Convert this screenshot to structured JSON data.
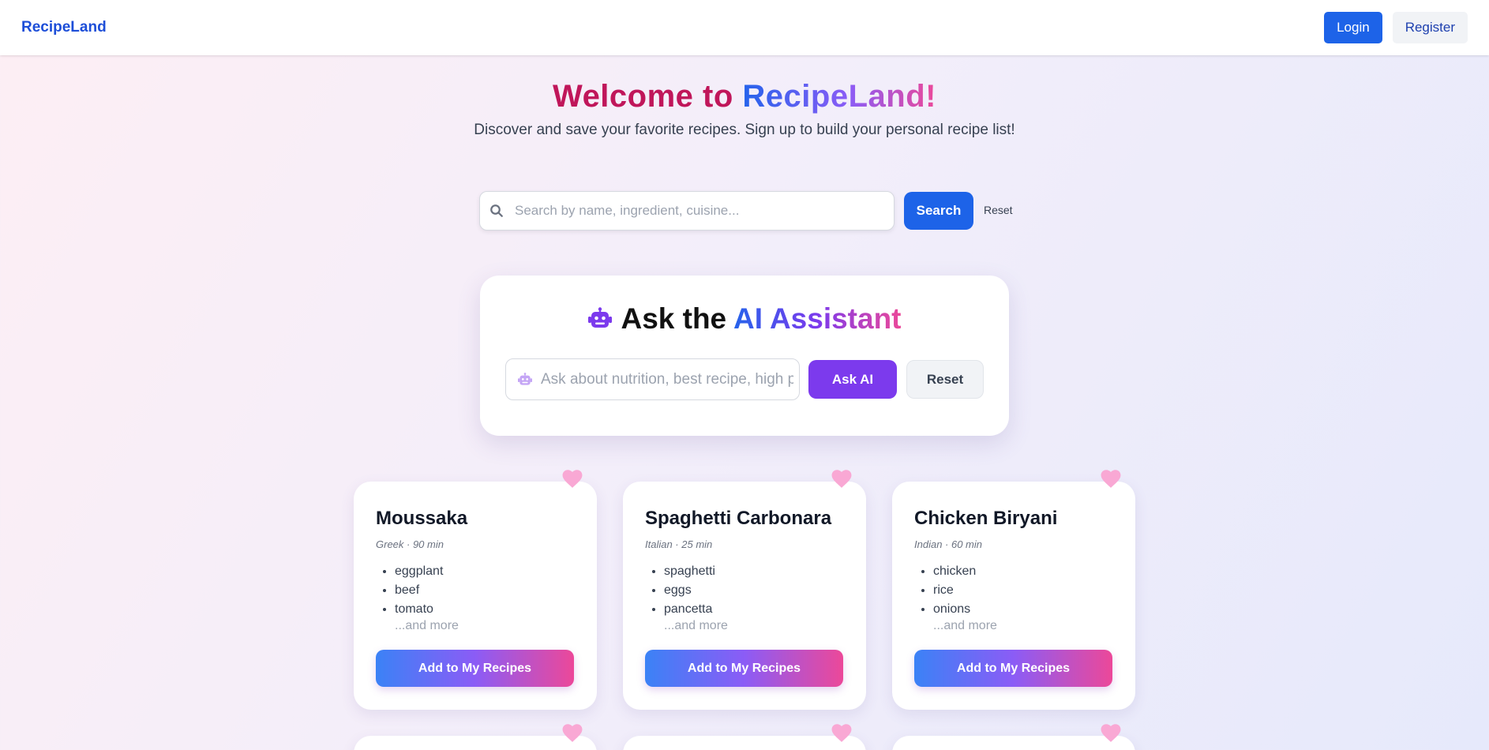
{
  "navbar": {
    "brand": "RecipeLand",
    "login_label": "Login",
    "register_label": "Register"
  },
  "hero": {
    "title_prefix": "Welcome to ",
    "title_brand": "RecipeLand!",
    "subtitle": "Discover and save your favorite recipes. Sign up to build your personal recipe list!"
  },
  "search": {
    "placeholder": "Search by name, ingredient, cuisine...",
    "value": "",
    "search_label": "Search",
    "reset_label": "Reset",
    "icon": "search-icon"
  },
  "ai_assistant": {
    "title_prefix": "Ask the ",
    "title_highlight": "AI Assistant",
    "placeholder": "Ask about nutrition, best recipe, high protein...",
    "value": "",
    "ask_label": "Ask AI",
    "reset_label": "Reset",
    "icon": "robot-icon"
  },
  "recipes": [
    {
      "name": "Moussaka",
      "meta": "Greek · 90 min",
      "ingredients": [
        "eggplant",
        "beef",
        "tomato"
      ],
      "more": "...and more",
      "add_label": "Add to My Recipes"
    },
    {
      "name": "Spaghetti Carbonara",
      "meta": "Italian · 25 min",
      "ingredients": [
        "spaghetti",
        "eggs",
        "pancetta"
      ],
      "more": "...and more",
      "add_label": "Add to My Recipes"
    },
    {
      "name": "Chicken Biryani",
      "meta": "Indian · 60 min",
      "ingredients": [
        "chicken",
        "rice",
        "onions"
      ],
      "more": "...and more",
      "add_label": "Add to My Recipes"
    }
  ],
  "colors": {
    "primary": "#1d63e8",
    "brand_text": "#1d4ed8",
    "title_pink": "#c0165a",
    "ai_purple": "#7c3aed",
    "heart": "#f9a8d4"
  }
}
